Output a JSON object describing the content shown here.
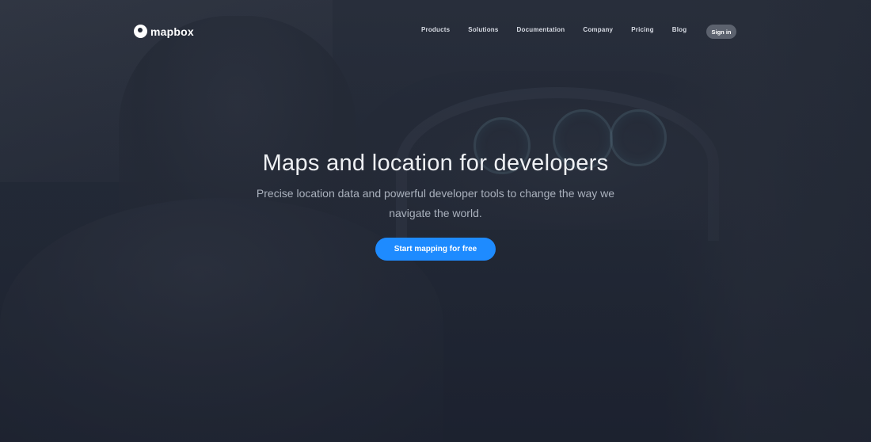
{
  "brand": {
    "logo_icon": "mapbox-logo-icon",
    "name": "mapbox"
  },
  "nav": {
    "items": [
      {
        "label": "Products"
      },
      {
        "label": "Solutions"
      },
      {
        "label": "Documentation"
      },
      {
        "label": "Company"
      },
      {
        "label": "Pricing"
      },
      {
        "label": "Blog"
      }
    ],
    "signin_label": "Sign in"
  },
  "hero": {
    "title": "Maps and location for developers",
    "subtitle": "Precise location data and powerful developer tools to change the way we navigate the world.",
    "cta_label": "Start mapping for free"
  },
  "colors": {
    "accent": "#1e8bff",
    "background": "#242a37",
    "signin_bg": "#5c626e"
  }
}
